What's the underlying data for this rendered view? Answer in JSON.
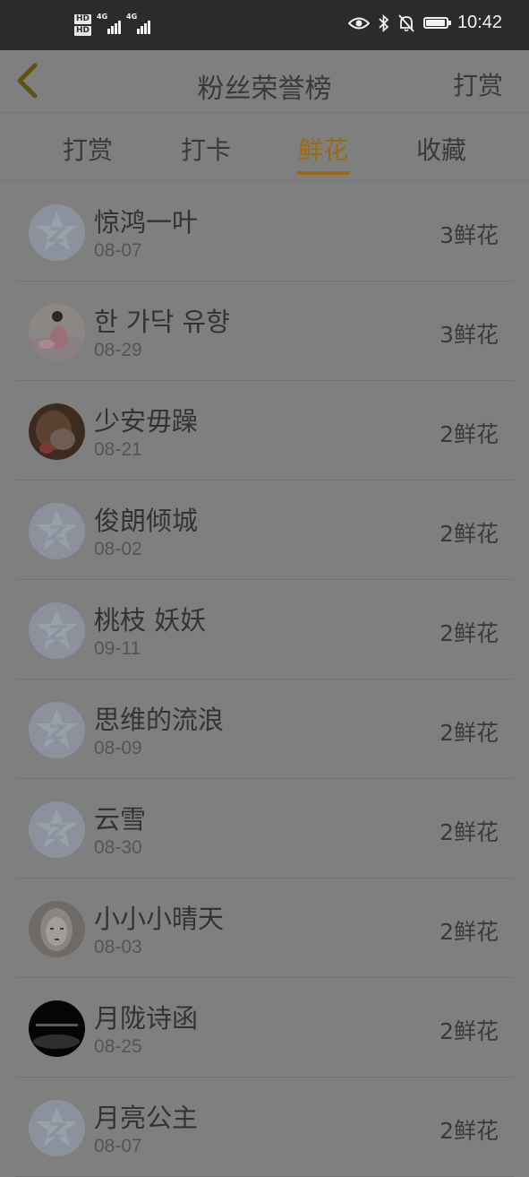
{
  "status_bar": {
    "hd1": "HD",
    "hd2": "HD",
    "net1": "4G",
    "net2": "4G",
    "time": "10:42",
    "battery_level": 0.95,
    "icons": [
      "eye-icon",
      "bluetooth-icon",
      "bell-off-icon",
      "battery-icon"
    ]
  },
  "header": {
    "back_icon": "chevron-left-icon",
    "title": "粉丝荣誉榜",
    "action_label": "打赏"
  },
  "tabs": [
    {
      "label": "打赏",
      "active": false
    },
    {
      "label": "打卡",
      "active": false
    },
    {
      "label": "鲜花",
      "active": true
    },
    {
      "label": "收藏",
      "active": false
    }
  ],
  "colors": {
    "accent": "#9c6a10",
    "status_bar": "#2b2b2b",
    "dimmed_background": "#7f7f7f"
  },
  "entries": [
    {
      "name": "惊鸿一叶",
      "date": "08-07",
      "count": "3鲜花",
      "avatar": "default"
    },
    {
      "name": "한 가닥 유향",
      "date": "08-29",
      "count": "3鲜花",
      "avatar": "photo-girl"
    },
    {
      "name": "少安毋躁",
      "date": "08-21",
      "count": "2鲜花",
      "avatar": "photo-brown"
    },
    {
      "name": "俊朗倾城",
      "date": "08-02",
      "count": "2鲜花",
      "avatar": "default"
    },
    {
      "name": "桃枝 妖妖",
      "date": "09-11",
      "count": "2鲜花",
      "avatar": "default"
    },
    {
      "name": "思维的流浪",
      "date": "08-09",
      "count": "2鲜花",
      "avatar": "default"
    },
    {
      "name": "云雪",
      "date": "08-30",
      "count": "2鲜花",
      "avatar": "default"
    },
    {
      "name": "小小小晴天",
      "date": "08-03",
      "count": "2鲜花",
      "avatar": "photo-face"
    },
    {
      "name": "月陇诗函",
      "date": "08-25",
      "count": "2鲜花",
      "avatar": "photo-dark"
    },
    {
      "name": "月亮公主",
      "date": "08-07",
      "count": "2鲜花",
      "avatar": "default"
    }
  ]
}
